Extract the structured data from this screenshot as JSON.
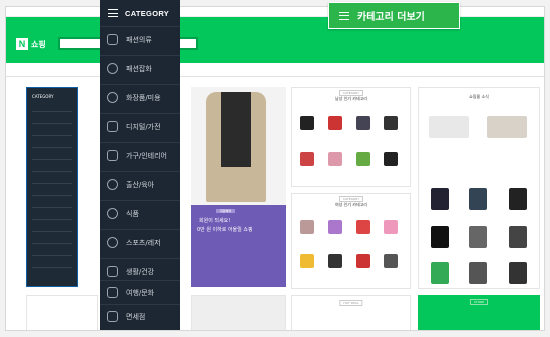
{
  "category_menu": {
    "header_label": "CATEGORY",
    "items": [
      {
        "label": "패션의류",
        "icon": "shirt-icon"
      },
      {
        "label": "패션잡화",
        "icon": "hat-icon"
      },
      {
        "label": "화장품/미용",
        "icon": "cosmetics-icon"
      },
      {
        "label": "디지털/가전",
        "icon": "monitor-icon"
      },
      {
        "label": "가구/인테리어",
        "icon": "sofa-icon"
      },
      {
        "label": "출산/육아",
        "icon": "stroller-icon"
      },
      {
        "label": "식품",
        "icon": "apple-icon"
      },
      {
        "label": "스포츠/레저",
        "icon": "bicycle-icon"
      },
      {
        "label": "생활/건강",
        "icon": "house-icon"
      },
      {
        "label": "여행/문화",
        "icon": "plane-icon"
      },
      {
        "label": "면세점",
        "icon": "duty-free-icon"
      }
    ]
  },
  "callout": {
    "label": "카테고리 더보기"
  },
  "background_page": {
    "logo_text": "쇼핑",
    "sidebar_header": "CATEGORY",
    "panel_labels": [
      "CATEGORY",
      "CATEGORY",
      "HOT DEAL",
      "STORE"
    ],
    "panel_titles": [
      "남성 인기 카테고리",
      "여성 인기 카테고리",
      "쇼핑몰 소식"
    ],
    "promo": {
      "badge": "회원혜택",
      "line1": "회원이 되세요!",
      "line2": "0만 원 이하로 어울릴 쇼핑"
    }
  },
  "colors": {
    "menu_bg": "#1d2733",
    "brand_green": "#03c75a",
    "callout_green": "#2cb54a"
  }
}
